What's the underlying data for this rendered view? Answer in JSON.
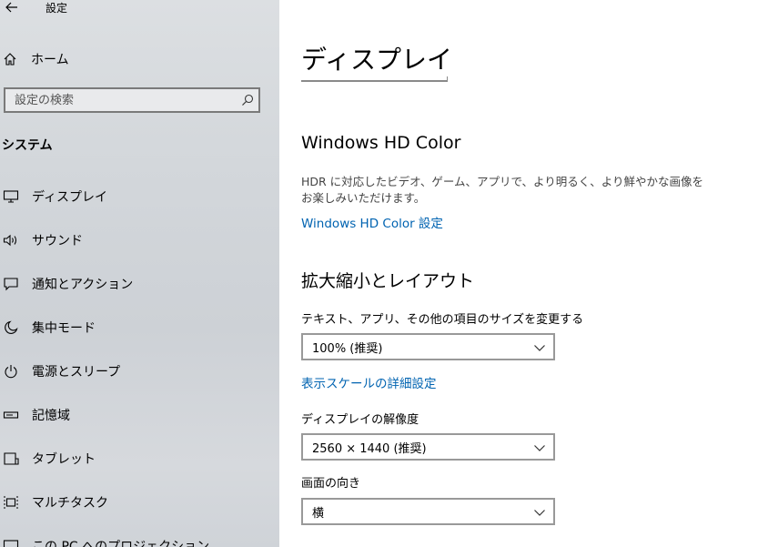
{
  "header": {
    "app_title": "設定"
  },
  "home": {
    "label": "ホーム"
  },
  "search": {
    "placeholder": "設定の検索"
  },
  "sidebar": {
    "section": "システム",
    "items": [
      {
        "label": "ディスプレイ",
        "icon": "monitor-icon"
      },
      {
        "label": "サウンド",
        "icon": "speaker-icon"
      },
      {
        "label": "通知とアクション",
        "icon": "notification-icon"
      },
      {
        "label": "集中モード",
        "icon": "moon-icon"
      },
      {
        "label": "電源とスリープ",
        "icon": "power-icon"
      },
      {
        "label": "記憶域",
        "icon": "storage-icon"
      },
      {
        "label": "タブレット",
        "icon": "tablet-icon"
      },
      {
        "label": "マルチタスク",
        "icon": "multitask-icon"
      },
      {
        "label": "この PC へのプロジェクション",
        "icon": "projection-icon"
      }
    ]
  },
  "main": {
    "title": "ディスプレイ",
    "hd_color": {
      "heading": "Windows HD Color",
      "description": "HDR に対応したビデオ、ゲーム、アプリで、より明るく、より鮮やかな画像をお楽しみいただけます。",
      "link": "Windows HD Color 設定"
    },
    "scale": {
      "heading": "拡大縮小とレイアウト",
      "size_label": "テキスト、アプリ、その他の項目のサイズを変更する",
      "size_value": "100% (推奨)",
      "advanced_link": "表示スケールの詳細設定",
      "resolution_label": "ディスプレイの解像度",
      "resolution_value": "2560 × 1440 (推奨)",
      "orientation_label": "画面の向き",
      "orientation_value": "横"
    }
  },
  "colors": {
    "link": "#0063b1",
    "sidebar_bg": "#d3d7db"
  }
}
